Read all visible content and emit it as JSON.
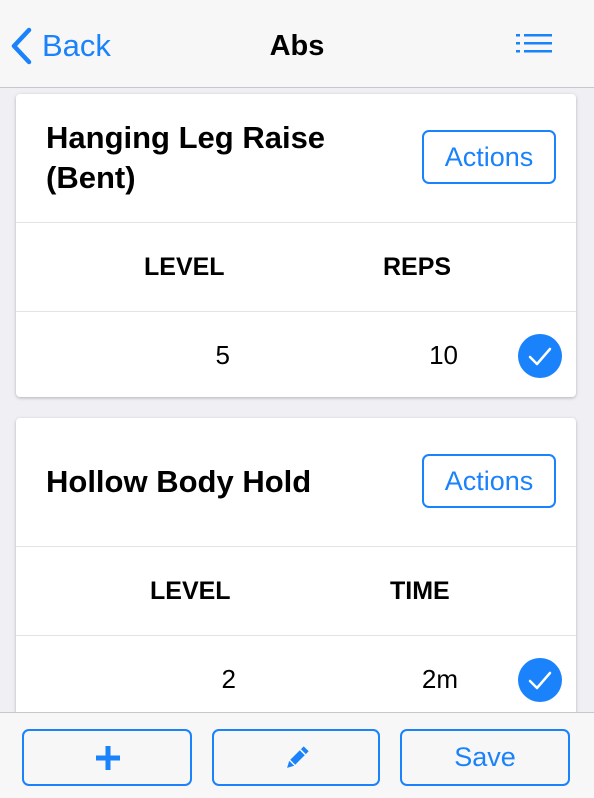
{
  "navbar": {
    "back_label": "Back",
    "title": "Abs"
  },
  "exercises": [
    {
      "name_line1": "Hanging Leg Raise",
      "name_line2": "(Bent)",
      "actions_label": "Actions",
      "columns": [
        "LEVEL",
        "REPS"
      ],
      "values": [
        "5",
        "10"
      ],
      "completed": true
    },
    {
      "name_line1": "Hollow Body Hold",
      "actions_label": "Actions",
      "columns": [
        "LEVEL",
        "TIME"
      ],
      "values": [
        "2",
        "2m"
      ],
      "completed": true
    }
  ],
  "toolbar": {
    "save_label": "Save"
  },
  "icons": {
    "back": "chevron-left-icon",
    "menu": "list-icon",
    "check": "checkmark-icon",
    "add": "plus-icon",
    "edit": "pencil-icon"
  },
  "colors": {
    "accent": "#1a82fb",
    "background": "#efeff4",
    "bar": "#f7f7f7"
  }
}
